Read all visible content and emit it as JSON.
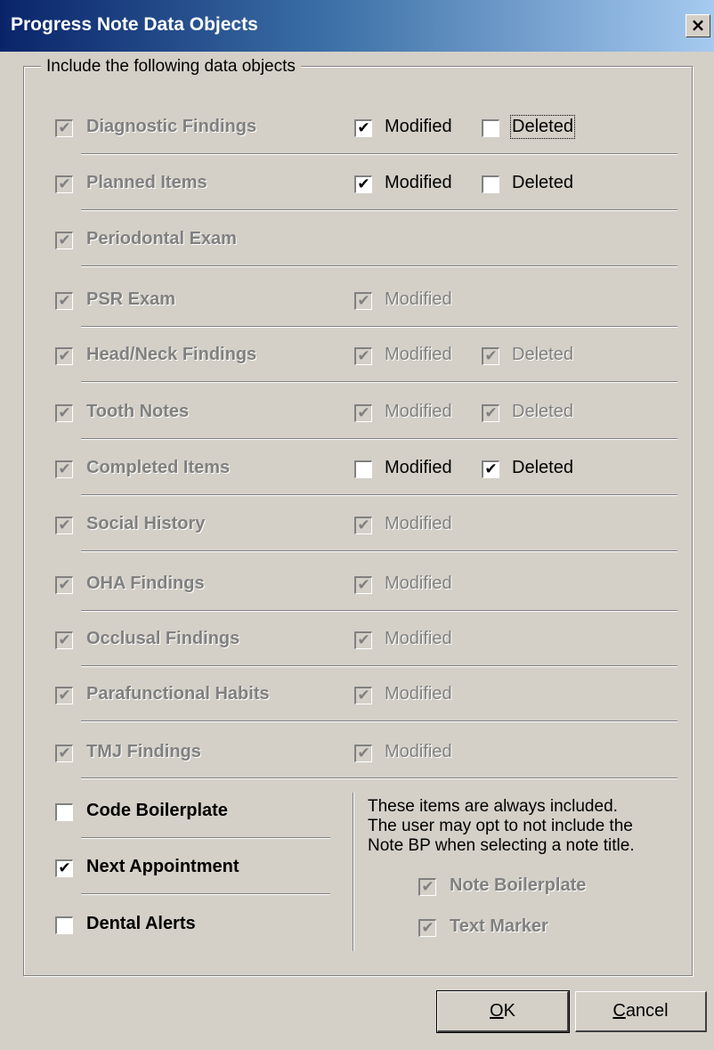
{
  "window": {
    "title": "Progress Note Data Objects",
    "close_glyph": "×"
  },
  "group": {
    "legend": "Include the following data objects"
  },
  "check_glyph": "✔",
  "objects": [
    {
      "label": "Diagnostic Findings",
      "checked": true,
      "enabled": false,
      "modified": {
        "label": "Modified",
        "checked": true,
        "enabled": true
      },
      "deleted": {
        "label": "Deleted",
        "checked": false,
        "enabled": true,
        "focused": true
      }
    },
    {
      "label": "Planned Items",
      "checked": true,
      "enabled": false,
      "modified": {
        "label": "Modified",
        "checked": true,
        "enabled": true
      },
      "deleted": {
        "label": "Deleted",
        "checked": false,
        "enabled": true
      }
    },
    {
      "label": "Periodontal Exam",
      "checked": true,
      "enabled": false
    },
    {
      "label": "PSR Exam",
      "checked": true,
      "enabled": false,
      "modified": {
        "label": "Modified",
        "checked": true,
        "enabled": false
      }
    },
    {
      "label": "Head/Neck Findings",
      "checked": true,
      "enabled": false,
      "modified": {
        "label": "Modified",
        "checked": true,
        "enabled": false
      },
      "deleted": {
        "label": "Deleted",
        "checked": true,
        "enabled": false
      }
    },
    {
      "label": "Tooth Notes",
      "checked": true,
      "enabled": false,
      "modified": {
        "label": "Modified",
        "checked": true,
        "enabled": false
      },
      "deleted": {
        "label": "Deleted",
        "checked": true,
        "enabled": false
      }
    },
    {
      "label": "Completed Items",
      "checked": true,
      "enabled": false,
      "modified": {
        "label": "Modified",
        "checked": false,
        "enabled": true
      },
      "deleted": {
        "label": "Deleted",
        "checked": true,
        "enabled": true
      }
    },
    {
      "label": "Social History",
      "checked": true,
      "enabled": false,
      "modified": {
        "label": "Modified",
        "checked": true,
        "enabled": false
      }
    },
    {
      "label": "OHA Findings",
      "checked": true,
      "enabled": false,
      "modified": {
        "label": "Modified",
        "checked": true,
        "enabled": false
      }
    },
    {
      "label": "Occlusal Findings",
      "checked": true,
      "enabled": false,
      "modified": {
        "label": "Modified",
        "checked": true,
        "enabled": false
      }
    },
    {
      "label": "Parafunctional Habits",
      "checked": true,
      "enabled": false,
      "modified": {
        "label": "Modified",
        "checked": true,
        "enabled": false
      }
    },
    {
      "label": "TMJ Findings",
      "checked": true,
      "enabled": false,
      "modified": {
        "label": "Modified",
        "checked": true,
        "enabled": false
      }
    }
  ],
  "optional": [
    {
      "label": "Code Boilerplate",
      "checked": false
    },
    {
      "label": "Next Appointment",
      "checked": true
    },
    {
      "label": "Dental Alerts",
      "checked": false
    }
  ],
  "info": {
    "lines": [
      "These items are always included.",
      "The user may opt to not include the",
      "Note BP when selecting a note title."
    ]
  },
  "always": [
    {
      "label": "Note Boilerplate",
      "checked": true
    },
    {
      "label": "Text Marker",
      "checked": true
    }
  ],
  "buttons": {
    "ok": {
      "mnemonic": "O",
      "rest": "K"
    },
    "cancel": {
      "mnemonic": "C",
      "rest": "ancel"
    }
  }
}
